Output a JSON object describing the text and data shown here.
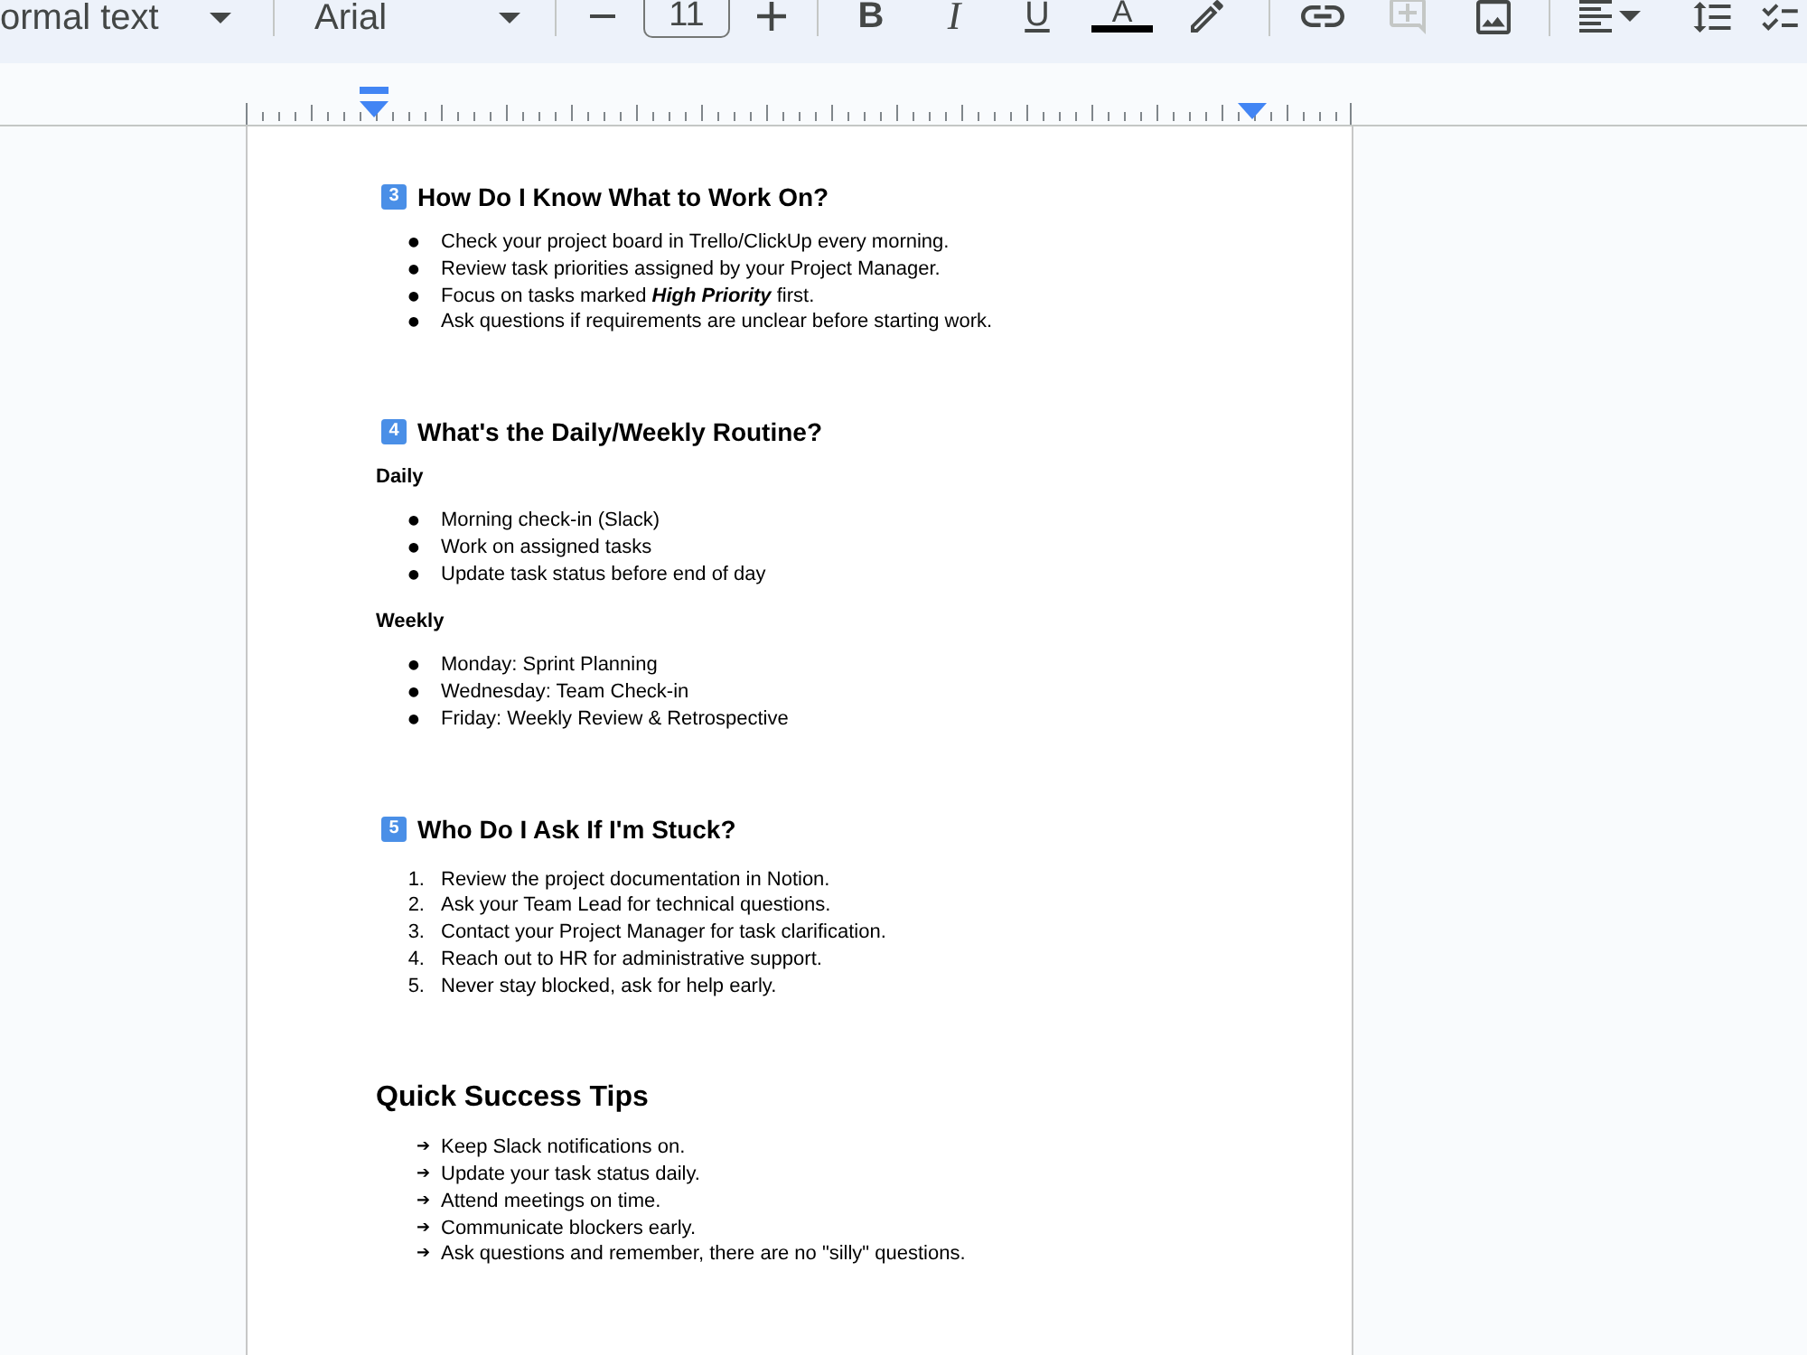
{
  "toolbar": {
    "groups": [
      [
        {
          "kind": "style_select",
          "value": "ormal text",
          "disabled": false
        }
      ],
      [
        {
          "kind": "font_select",
          "value": "Arial",
          "disabled": false
        }
      ],
      [
        {
          "kind": "decrease",
          "disabled": false
        },
        {
          "kind": "size",
          "value": "11",
          "disabled": false
        },
        {
          "kind": "increase",
          "disabled": false
        }
      ],
      [
        {
          "kind": "bold",
          "label": "B",
          "disabled": false
        },
        {
          "kind": "italic",
          "label": "I",
          "disabled": false
        },
        {
          "kind": "underline",
          "label": "U",
          "disabled": false
        },
        {
          "kind": "text_color",
          "label": "A",
          "color": "#000000",
          "disabled": false
        },
        {
          "kind": "highlight",
          "disabled": false
        }
      ],
      [
        {
          "kind": "link",
          "disabled": false
        },
        {
          "kind": "comment",
          "disabled": true
        },
        {
          "kind": "image",
          "disabled": false
        }
      ],
      [
        {
          "kind": "align",
          "disabled": false
        },
        {
          "kind": "line_spacing",
          "disabled": false
        },
        {
          "kind": "checklist",
          "disabled": false
        }
      ]
    ]
  },
  "document": {
    "sections": [
      {
        "kind": "keycap",
        "number": "3",
        "title": "How Do I Know What to Work On?",
        "blocks": [
          {
            "kind": "bullet_list",
            "items": [
              {
                "marker": "●",
                "text": "Check your project board in Trello/ClickUp every morning."
              },
              {
                "marker": "●",
                "text": "Review task priorities assigned by your Project Manager."
              },
              {
                "marker": "●",
                "text": "Focus on tasks marked **High Priority** first."
              },
              {
                "marker": "●",
                "text": "Ask questions if requirements are unclear before starting work."
              }
            ]
          }
        ]
      },
      {
        "kind": "keycap",
        "number": "4",
        "title": "What's the Daily/Weekly Routine?",
        "blocks": [
          {
            "kind": "subheading",
            "text": "Daily"
          },
          {
            "kind": "bullet_list",
            "items": [
              {
                "marker": "●",
                "text": "Morning check-in (Slack)"
              },
              {
                "marker": "●",
                "text": "Work on assigned tasks"
              },
              {
                "marker": "●",
                "text": "Update task status before end of day"
              }
            ]
          },
          {
            "kind": "subheading",
            "text": "Weekly"
          },
          {
            "kind": "bullet_list",
            "items": [
              {
                "marker": "●",
                "text": "Monday: Sprint Planning"
              },
              {
                "marker": "●",
                "text": "Wednesday: Team Check-in"
              },
              {
                "marker": "●",
                "text": "Friday: Weekly Review & Retrospective"
              }
            ]
          }
        ]
      },
      {
        "kind": "keycap",
        "number": "5",
        "title": "Who Do I Ask If I'm Stuck?",
        "blocks": [
          {
            "kind": "numbered_list",
            "items": [
              {
                "marker": "1.",
                "text": "Review the project documentation in Notion."
              },
              {
                "marker": "2.",
                "text": "Ask your Team Lead for technical questions."
              },
              {
                "marker": "3.",
                "text": "Contact your Project Manager for task clarification."
              },
              {
                "marker": "4.",
                "text": "Reach out to HR for administrative support."
              },
              {
                "marker": "5.",
                "text": "Never stay blocked, ask for help early."
              }
            ]
          }
        ]
      },
      {
        "kind": "plain",
        "title": "Quick Success Tips",
        "blocks": [
          {
            "kind": "arrow_list",
            "items": [
              {
                "marker": "➔",
                "text": "Keep Slack notifications on."
              },
              {
                "marker": "➔",
                "text": "Update your task status daily."
              },
              {
                "marker": "➔",
                "text": "Attend meetings on time."
              },
              {
                "marker": "➔",
                "text": "Communicate blockers early."
              },
              {
                "marker": "➔",
                "text": "Ask questions and remember, there are no \"silly\" questions."
              }
            ]
          }
        ]
      }
    ]
  }
}
